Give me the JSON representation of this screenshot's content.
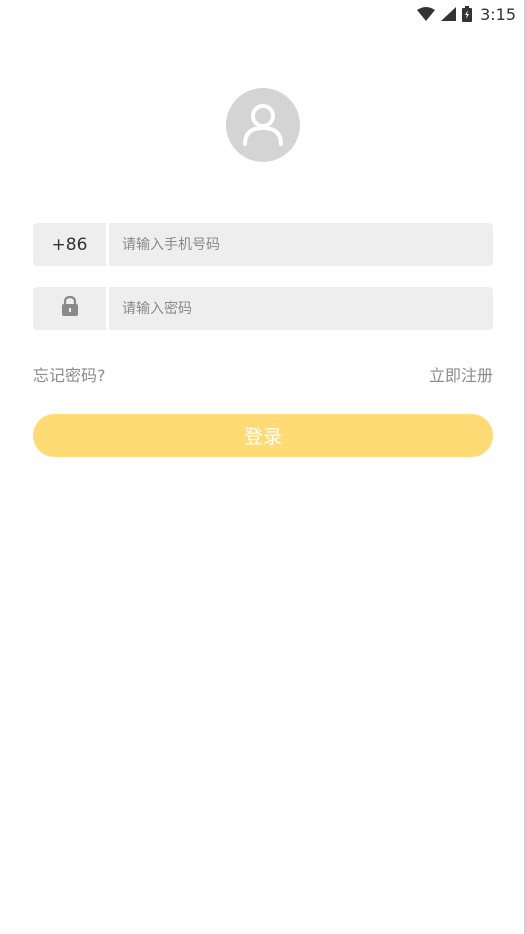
{
  "status_bar": {
    "time": "3:15",
    "icons": [
      "wifi-icon",
      "cellular-signal-icon",
      "battery-charging-icon"
    ]
  },
  "avatar": {
    "icon": "user-avatar-icon"
  },
  "phone_row": {
    "country_code": "+86",
    "placeholder": "请输入手机号码",
    "value": ""
  },
  "password_row": {
    "icon": "lock-icon",
    "placeholder": "请输入密码",
    "value": ""
  },
  "links": {
    "forgot_password": "忘记密码?",
    "register": "立即注册"
  },
  "login_button": {
    "label": "登录"
  },
  "colors": {
    "accent": "#fedb74",
    "input_bg": "#eeeeee",
    "avatar_bg": "#d4d4d4",
    "link_text": "#8c8c8c"
  }
}
